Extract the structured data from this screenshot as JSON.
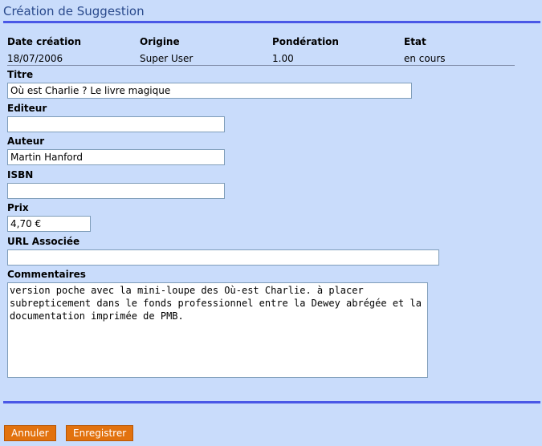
{
  "page": {
    "title": "Création de Suggestion"
  },
  "meta": {
    "headers": [
      "Date création",
      "Origine",
      "Pondération",
      "Etat"
    ],
    "values": [
      "18/07/2006",
      "Super User",
      "1.00",
      "en cours"
    ]
  },
  "form": {
    "titre": {
      "label": "Titre",
      "value": "Où est Charlie ? Le livre magique"
    },
    "editeur": {
      "label": "Editeur",
      "value": ""
    },
    "auteur": {
      "label": "Auteur",
      "value": "Martin Hanford"
    },
    "isbn": {
      "label": "ISBN",
      "value": ""
    },
    "prix": {
      "label": "Prix",
      "value": "4,70 €"
    },
    "url": {
      "label": "URL Associée",
      "value": ""
    },
    "commentaires": {
      "label": "Commentaires",
      "value": "version poche avec la mini-loupe des Où-est Charlie. à placer subrepticement dans le fonds professionnel entre la Dewey abrégée et la documentation imprimée de PMB."
    }
  },
  "buttons": {
    "cancel": "Annuler",
    "save": "Enregistrer"
  },
  "colors": {
    "background": "#c9dcfb",
    "rule": "#4a58e6",
    "button": "#e2720e",
    "title": "#2a4a8c"
  }
}
